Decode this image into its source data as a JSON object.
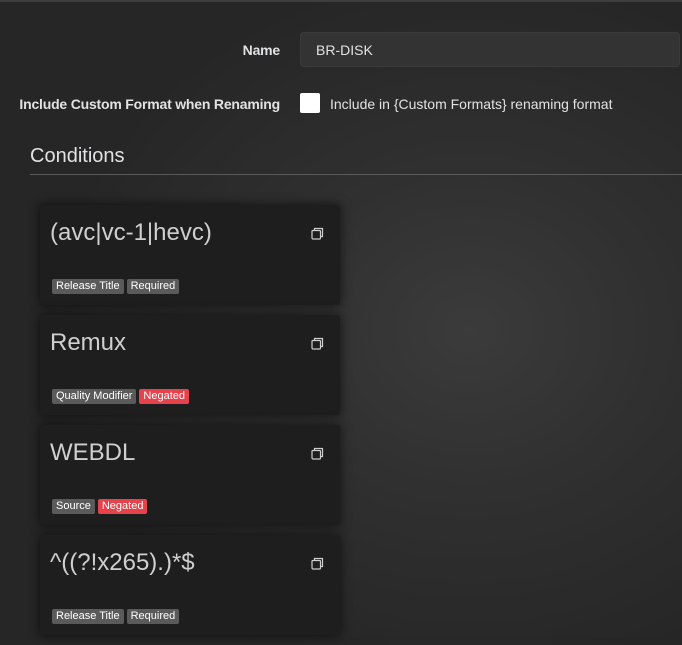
{
  "form": {
    "name_label": "Name",
    "name_value": "BR-DISK",
    "rename_label": "Include Custom Format when Renaming",
    "rename_checkbox_text": "Include in {Custom Formats} renaming format",
    "rename_checked": false
  },
  "conditions": {
    "title": "Conditions",
    "items": [
      {
        "title": "(avc|vc-1|hevc)",
        "badges": [
          {
            "text": "Release Title",
            "kind": "default"
          },
          {
            "text": "Required",
            "kind": "default"
          }
        ]
      },
      {
        "title": "Remux",
        "badges": [
          {
            "text": "Quality Modifier",
            "kind": "default"
          },
          {
            "text": "Negated",
            "kind": "danger"
          }
        ]
      },
      {
        "title": "WEBDL",
        "badges": [
          {
            "text": "Source",
            "kind": "default"
          },
          {
            "text": "Negated",
            "kind": "danger"
          }
        ]
      },
      {
        "title": "^((?!x265).)*$",
        "badges": [
          {
            "text": "Release Title",
            "kind": "default"
          },
          {
            "text": "Required",
            "kind": "default"
          }
        ]
      }
    ],
    "clone_icon": "clone-icon"
  },
  "colors": {
    "badge_default": "#5a5a5a",
    "badge_danger": "#e5424b",
    "card_background": "#1e1e1e",
    "text": "#e1e2e3"
  }
}
